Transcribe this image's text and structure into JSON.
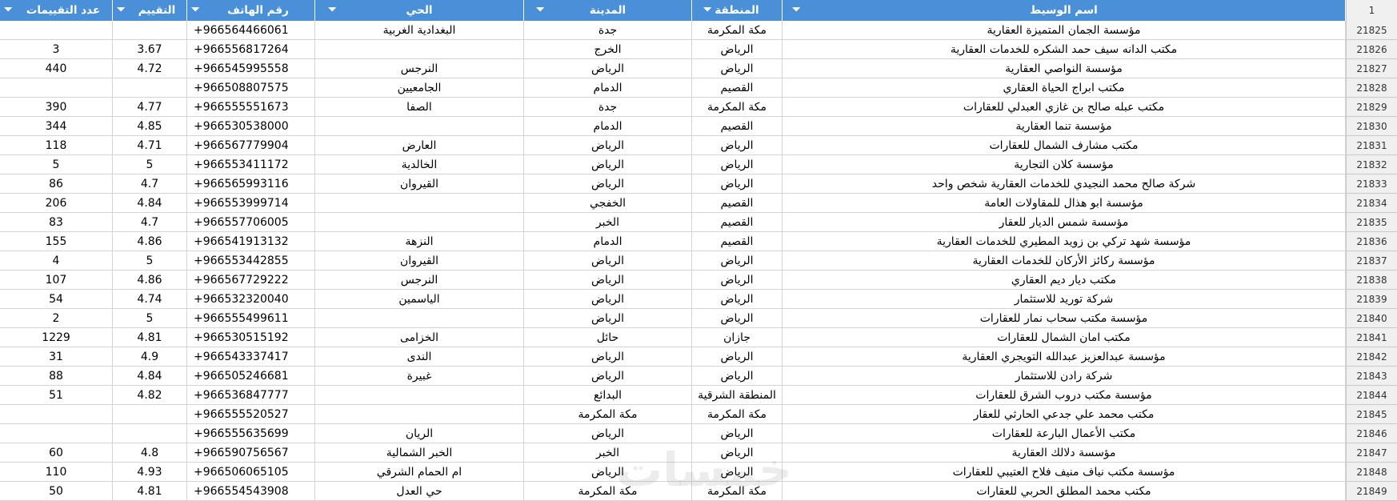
{
  "headers": {
    "ratings_count": "عدد التقييمات",
    "rating": "التقييم",
    "phone": "رقم الهاتف",
    "district": "الحي",
    "city": "المدينة",
    "region": "المنطقة",
    "broker_name": "اسم الوسيط",
    "header_row_number": "1"
  },
  "filter_icon": "chevron-down-icon",
  "rows": [
    {
      "n": "21825",
      "name": "مؤسسة الجمان المتميزة العقارية",
      "region": "مكة المكرمة",
      "city": "جدة",
      "district": "البغدادية الغربية",
      "phone": "+966564466061",
      "rating": "",
      "count": ""
    },
    {
      "n": "21826",
      "name": "مكتب الدانه سيف حمد الشكره للخدمات العقارية",
      "region": "الرياض",
      "city": "الخرج",
      "district": "",
      "phone": "+966556817264",
      "rating": "3.67",
      "count": "3"
    },
    {
      "n": "21827",
      "name": "مؤسسة النواصي العقارية",
      "region": "الرياض",
      "city": "الرياض",
      "district": "النرجس",
      "phone": "+966545995558",
      "rating": "4.72",
      "count": "440"
    },
    {
      "n": "21828",
      "name": "مكتب ابراج الحياة العقاري",
      "region": "القصيم",
      "city": "الدمام",
      "district": "الجامعيين",
      "phone": "+966508807575",
      "rating": "",
      "count": ""
    },
    {
      "n": "21829",
      "name": "مكتب عبله صالح بن غازي العبدلي للعقارات",
      "region": "مكة المكرمة",
      "city": "جدة",
      "district": "الصفا",
      "phone": "+966555551673",
      "rating": "4.77",
      "count": "390"
    },
    {
      "n": "21830",
      "name": "مؤسسة تنما العقارية",
      "region": "القصيم",
      "city": "الدمام",
      "district": "",
      "phone": "+966530538000",
      "rating": "4.85",
      "count": "344"
    },
    {
      "n": "21831",
      "name": "مكتب مشارف الشمال للعقارات",
      "region": "الرياض",
      "city": "الرياض",
      "district": "العارض",
      "phone": "+966567779904",
      "rating": "4.71",
      "count": "118"
    },
    {
      "n": "21832",
      "name": "مؤسسة كلان التجارية",
      "region": "الرياض",
      "city": "الرياض",
      "district": "الخالدية",
      "phone": "+966553411172",
      "rating": "5",
      "count": "5"
    },
    {
      "n": "21833",
      "name": "شركة صالح محمد النجيدي للخدمات العقارية شخص واحد",
      "region": "الرياض",
      "city": "الرياض",
      "district": "القيروان",
      "phone": "+966565993116",
      "rating": "4.7",
      "count": "86"
    },
    {
      "n": "21834",
      "name": "مؤسسة ابو هذال للمقاولات العامة",
      "region": "القصيم",
      "city": "الخفجي",
      "district": "",
      "phone": "+966553999714",
      "rating": "4.84",
      "count": "206"
    },
    {
      "n": "21835",
      "name": "مؤسسة شمس الديار للعقار",
      "region": "القصيم",
      "city": "الخبر",
      "district": "",
      "phone": "+966557706005",
      "rating": "4.7",
      "count": "83"
    },
    {
      "n": "21836",
      "name": "مؤسسة شهد تركي بن زويد المطيري للخدمات العقارية",
      "region": "القصيم",
      "city": "الدمام",
      "district": "النزهة",
      "phone": "+966541913132",
      "rating": "4.86",
      "count": "155"
    },
    {
      "n": "21837",
      "name": "مؤسسة ركائز الأركان للخدمات العقارية",
      "region": "الرياض",
      "city": "الرياض",
      "district": "القيروان",
      "phone": "+966553442855",
      "rating": "5",
      "count": "4"
    },
    {
      "n": "21838",
      "name": "مكتب ديار ديم العقاري",
      "region": "الرياض",
      "city": "الرياض",
      "district": "النرجس",
      "phone": "+966567729222",
      "rating": "4.86",
      "count": "107"
    },
    {
      "n": "21839",
      "name": "شركة توريد للاستثمار",
      "region": "الرياض",
      "city": "الرياض",
      "district": "الياسمين",
      "phone": "+966532320040",
      "rating": "4.74",
      "count": "54"
    },
    {
      "n": "21840",
      "name": "مؤسسة مكتب سحاب نمار للعقارات",
      "region": "الرياض",
      "city": "الرياض",
      "district": "",
      "phone": "+966555499611",
      "rating": "5",
      "count": "2"
    },
    {
      "n": "21841",
      "name": "مكتب امان الشمال للعقارات",
      "region": "جازان",
      "city": "حائل",
      "district": "الخزامى",
      "phone": "+966530515192",
      "rating": "4.81",
      "count": "1229"
    },
    {
      "n": "21842",
      "name": "مؤسسة عبدالعزيز عبدالله التويجري العقارية",
      "region": "الرياض",
      "city": "الرياض",
      "district": "الندى",
      "phone": "+966543337417",
      "rating": "4.9",
      "count": "31"
    },
    {
      "n": "21843",
      "name": "شركة رادن للاستثمار",
      "region": "الرياض",
      "city": "الرياض",
      "district": "غبيرة",
      "phone": "+966505246681",
      "rating": "4.84",
      "count": "88"
    },
    {
      "n": "21844",
      "name": "مؤسسة مكتب دروب الشرق للعقارات",
      "region": "المنطقة الشرقية",
      "city": "البدائع",
      "district": "",
      "phone": "+966536847777",
      "rating": "4.82",
      "count": "51"
    },
    {
      "n": "21845",
      "name": "مكتب محمد علي جدعي الحارثي للعقار",
      "region": "مكة المكرمة",
      "city": "مكة المكرمة",
      "district": "",
      "phone": "+966555520527",
      "rating": "",
      "count": ""
    },
    {
      "n": "21846",
      "name": "مكتب الأعمال البارعة للعقارات",
      "region": "الرياض",
      "city": "الرياض",
      "district": "الريان",
      "phone": "+966555635699",
      "rating": "",
      "count": ""
    },
    {
      "n": "21847",
      "name": "مؤسسة دلالك العقارية",
      "region": "الرياض",
      "city": "الخبر",
      "district": "الخبر الشمالية",
      "phone": "+966590756567",
      "rating": "4.8",
      "count": "60"
    },
    {
      "n": "21848",
      "name": "مؤسسة مكتب نياف منيف فلاح العتيبي للعقارات",
      "region": "الرياض",
      "city": "الرياض",
      "district": "ام الحمام الشرقي",
      "phone": "+966506065105",
      "rating": "4.93",
      "count": "110"
    },
    {
      "n": "21849",
      "name": "مكتب محمد المطلق الحربي للعقارات",
      "region": "مكة المكرمة",
      "city": "مكة المكرمة",
      "district": "حي العدل",
      "phone": "+966554543908",
      "rating": "4.81",
      "count": "50"
    }
  ],
  "watermark": "خمسات"
}
